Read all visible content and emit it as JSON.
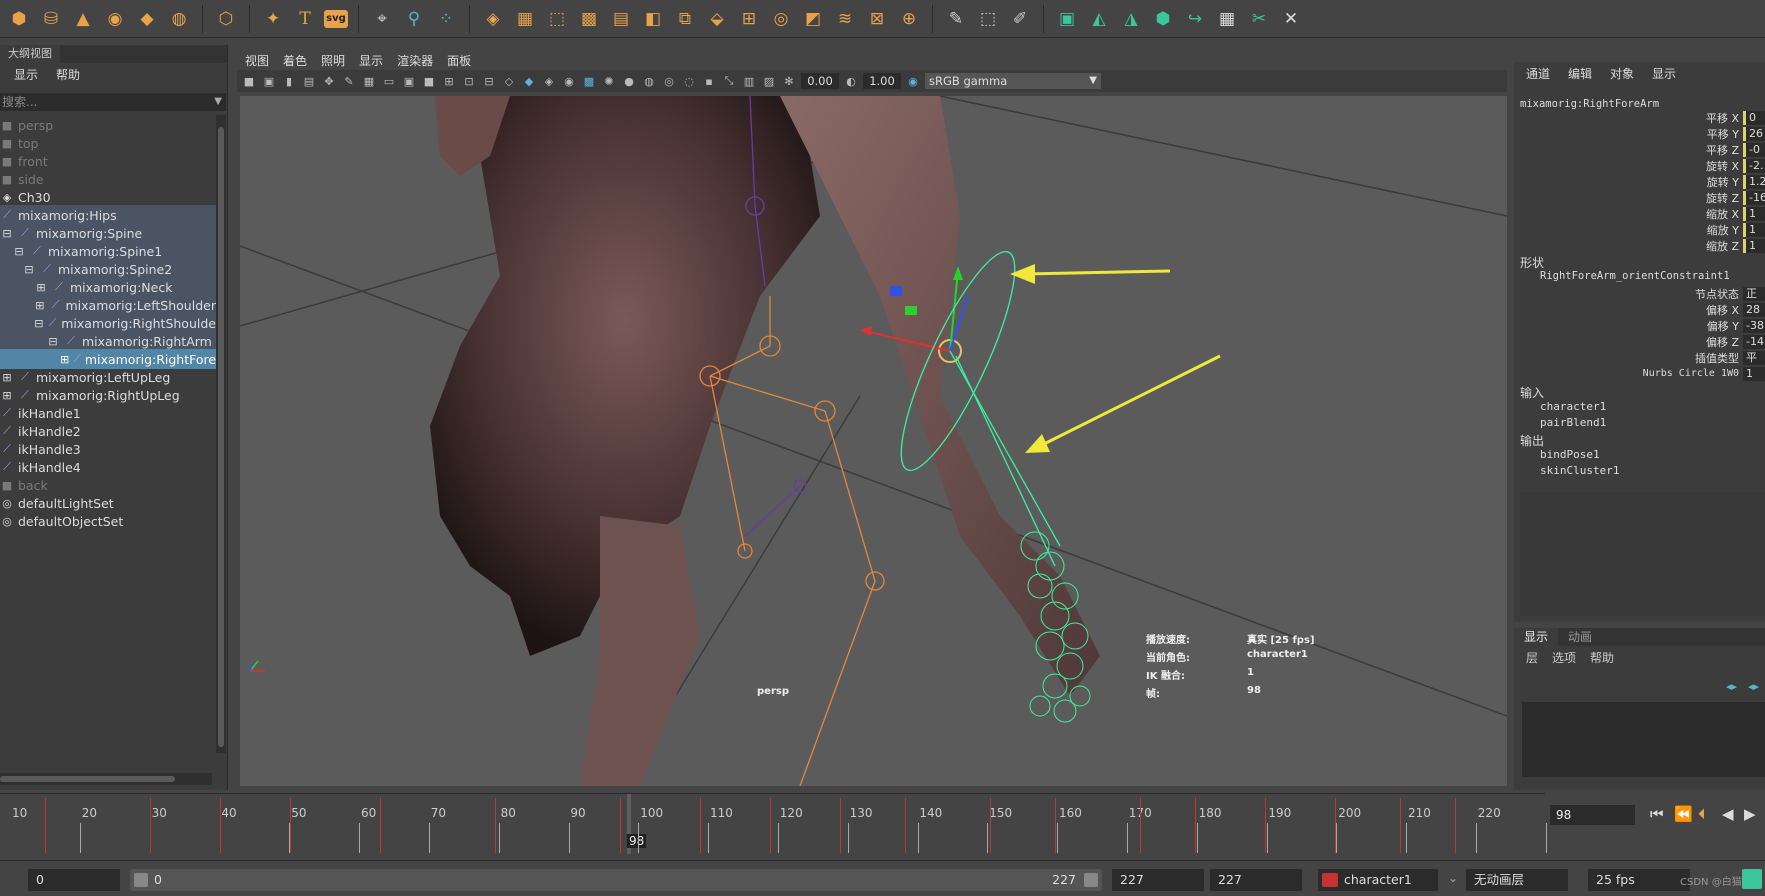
{
  "outliner": {
    "tab": "大纲视图",
    "menu": [
      "显示",
      "帮助"
    ],
    "search_placeholder": "搜索...",
    "items": [
      {
        "label": "persp"
      },
      {
        "label": "top"
      },
      {
        "label": "front"
      },
      {
        "label": "side"
      },
      {
        "label": "Ch30"
      },
      {
        "label": "mixamorig:Hips"
      },
      {
        "label": "mixamorig:Spine"
      },
      {
        "label": "mixamorig:Spine1"
      },
      {
        "label": "mixamorig:Spine2"
      },
      {
        "label": "mixamorig:Neck"
      },
      {
        "label": "mixamorig:LeftShoulder"
      },
      {
        "label": "mixamorig:RightShoulde"
      },
      {
        "label": "mixamorig:RightArm"
      },
      {
        "label": "mixamorig:RightFore"
      },
      {
        "label": "mixamorig:LeftUpLeg"
      },
      {
        "label": "mixamorig:RightUpLeg"
      },
      {
        "label": "ikHandle1"
      },
      {
        "label": "ikHandle2"
      },
      {
        "label": "ikHandle3"
      },
      {
        "label": "ikHandle4"
      },
      {
        "label": "back"
      },
      {
        "label": "defaultLightSet"
      },
      {
        "label": "defaultObjectSet"
      }
    ]
  },
  "panel": {
    "menu": [
      "视图",
      "着色",
      "照明",
      "显示",
      "渲染器",
      "面板"
    ],
    "exposure": "0.00",
    "gamma": "1.00",
    "colorspace": "sRGB gamma",
    "camera_label": "persp",
    "hud": {
      "playback_label": "播放速度:",
      "playback_value": "真实 [25 fps]",
      "character_label": "当前角色:",
      "character_value": "character1",
      "ik_label": "IK 融合:",
      "ik_value": "1",
      "frame_label": "帧:",
      "frame_value": "98"
    }
  },
  "channelbox": {
    "menu": [
      "通道",
      "编辑",
      "对象",
      "显示"
    ],
    "node": "mixamorig:RightForeArm",
    "attrs": [
      {
        "name": "平移 X",
        "value": "0"
      },
      {
        "name": "平移 Y",
        "value": "26"
      },
      {
        "name": "平移 Z",
        "value": "-0"
      },
      {
        "name": "旋转 X",
        "value": "-2."
      },
      {
        "name": "旋转 Y",
        "value": "1.2"
      },
      {
        "name": "旋转 Z",
        "value": "-16"
      },
      {
        "name": "缩放 X",
        "value": "1"
      },
      {
        "name": "缩放 Y",
        "value": "1"
      },
      {
        "name": "缩放 Z",
        "value": "1"
      }
    ],
    "shape_title": "形状",
    "shape_node": "RightForeArm_orientConstraint1",
    "shape_attrs": [
      {
        "name": "节点状态",
        "value": "正常"
      },
      {
        "name": "偏移 X",
        "value": "28"
      },
      {
        "name": "偏移 Y",
        "value": "-38"
      },
      {
        "name": "偏移 Z",
        "value": "-14"
      },
      {
        "name": "插值类型",
        "value": "平均"
      },
      {
        "name": "Nurbs Circle 1W0",
        "value": "1"
      }
    ],
    "inputs_title": "输入",
    "inputs": [
      "character1",
      "pairBlend1"
    ],
    "outputs_title": "输出",
    "outputs": [
      "bindPose1",
      "skinCluster1"
    ]
  },
  "layers": {
    "tabs": [
      "显示",
      "动画"
    ],
    "menu": [
      "层",
      "选项",
      "帮助"
    ]
  },
  "timeline": {
    "ticks": [
      "10",
      "20",
      "30",
      "40",
      "50",
      "60",
      "70",
      "80",
      "90",
      "100",
      "110",
      "120",
      "130",
      "140",
      "150",
      "160",
      "170",
      "180",
      "190",
      "200",
      "210",
      "220"
    ],
    "current": "98",
    "frame_field": "98"
  },
  "range": {
    "start": "0",
    "slider_start": "0",
    "slider_end": "227",
    "end": "227",
    "end2": "227",
    "character": "character1",
    "anim_layer": "无动画层",
    "fps": "25 fps"
  },
  "watermark": "CSDN @白猫Tigu"
}
